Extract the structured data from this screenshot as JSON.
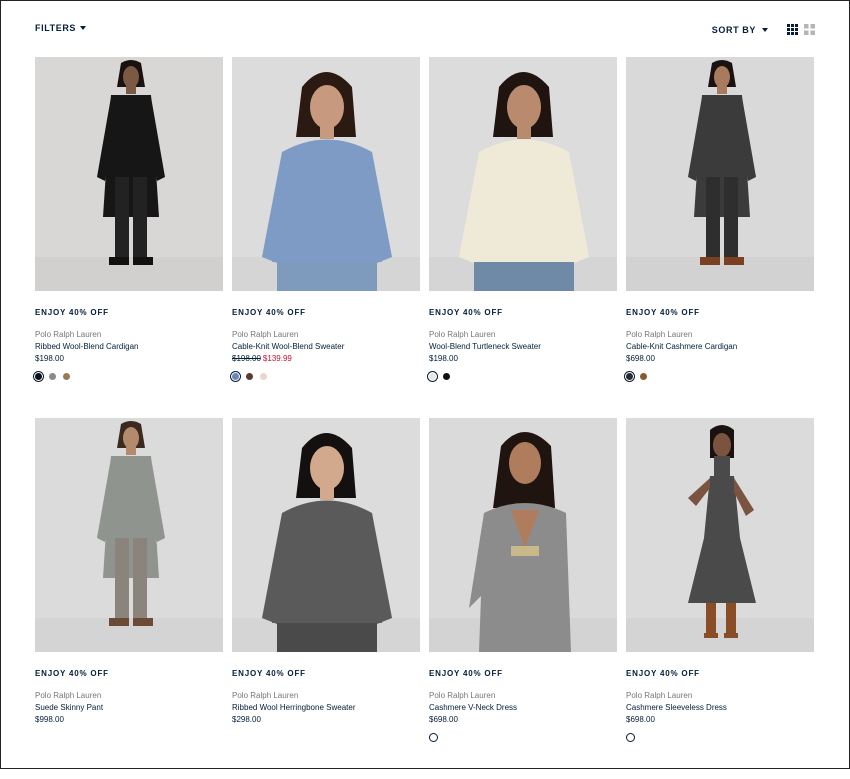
{
  "toolbar": {
    "filters_label": "FILTERS",
    "sort_label": "SORT BY"
  },
  "products": [
    {
      "promo": "ENJOY 40% OFF",
      "brand": "Polo Ralph Lauren",
      "name": "Ribbed Wool-Blend Cardigan",
      "price": "$198.00",
      "sale_price": "",
      "swatches": [
        "#111111",
        "#8a8a8a",
        "#9a7a52"
      ],
      "selected_swatch": 0,
      "look": {
        "bg": "#d8d7d5",
        "top": "#161616",
        "bottom": "#222222",
        "skin": "#7a5a44",
        "hair": "#1a1210",
        "shoes": "#111111",
        "style": "long-coat"
      }
    },
    {
      "promo": "ENJOY 40% OFF",
      "brand": "Polo Ralph Lauren",
      "name": "Cable-Knit Wool-Blend Sweater",
      "price": "$198.00",
      "sale_price": "$139.99",
      "swatches": [
        "#6f86b3",
        "#5a3a32",
        "#e9d6d0"
      ],
      "selected_swatch": 0,
      "look": {
        "bg": "#dcdcdc",
        "top": "#7e9bc6",
        "bottom": "#7e9bbd",
        "skin": "#c79a7f",
        "hair": "#2a1a12",
        "shoes": "#7e9bbd",
        "style": "crop"
      }
    },
    {
      "promo": "ENJOY 40% OFF",
      "brand": "Polo Ralph Lauren",
      "name": "Wool-Blend Turtleneck Sweater",
      "price": "$198.00",
      "sale_price": "",
      "swatches": [
        "#ece8dc",
        "#111111"
      ],
      "selected_swatch": 0,
      "look": {
        "bg": "#dcdcdc",
        "top": "#efead8",
        "bottom": "#6f8aa6",
        "skin": "#b98a6e",
        "hair": "#1f1410",
        "shoes": "#6f8aa6",
        "style": "crop"
      }
    },
    {
      "promo": "ENJOY 40% OFF",
      "brand": "Polo Ralph Lauren",
      "name": "Cable-Knit Cashmere Cardigan",
      "price": "$698.00",
      "sale_price": "",
      "swatches": [
        "#2b2b2b",
        "#8a5a2e"
      ],
      "selected_swatch": 0,
      "look": {
        "bg": "#d9d9d9",
        "top": "#3b3b3b",
        "bottom": "#2e2e2e",
        "skin": "#a87b5e",
        "hair": "#1a1210",
        "shoes": "#7b3f22",
        "style": "long-coat"
      }
    },
    {
      "promo": "ENJOY 40% OFF",
      "brand": "Polo Ralph Lauren",
      "name": "Suede Skinny Pant",
      "price": "$998.00",
      "sale_price": "",
      "swatches": [],
      "selected_swatch": -1,
      "look": {
        "bg": "#dbdbdb",
        "top": "#8f948e",
        "bottom": "#8a847c",
        "skin": "#b48a6c",
        "hair": "#3a2a20",
        "shoes": "#6b4a36",
        "style": "long-coat"
      }
    },
    {
      "promo": "ENJOY 40% OFF",
      "brand": "Polo Ralph Lauren",
      "name": "Ribbed Wool Herringbone Sweater",
      "price": "$298.00",
      "sale_price": "",
      "swatches": [],
      "selected_swatch": -1,
      "look": {
        "bg": "#dcdcdc",
        "top": "#5a5a5a",
        "bottom": "#4a4a4a",
        "skin": "#d2a98c",
        "hair": "#151010",
        "shoes": "#4a4a4a",
        "style": "crop"
      }
    },
    {
      "promo": "ENJOY 40% OFF",
      "brand": "Polo Ralph Lauren",
      "name": "Cashmere V-Neck Dress",
      "price": "$698.00",
      "sale_price": "",
      "swatches": [
        "empty"
      ],
      "selected_swatch": -1,
      "look": {
        "bg": "#dadada",
        "top": "#8c8c8c",
        "bottom": "#8c8c8c",
        "skin": "#b07c5e",
        "hair": "#1f1410",
        "shoes": "#8c8c8c",
        "style": "dress-crop"
      }
    },
    {
      "promo": "ENJOY 40% OFF",
      "brand": "Polo Ralph Lauren",
      "name": "Cashmere Sleeveless Dress",
      "price": "$698.00",
      "sale_price": "",
      "swatches": [
        "empty"
      ],
      "selected_swatch": -1,
      "look": {
        "bg": "#dbdbdb",
        "top": "#4a4a4a",
        "bottom": "#4a4a4a",
        "skin": "#7a5440",
        "hair": "#1a1210",
        "shoes": "#8a4e26",
        "style": "dress-full"
      }
    }
  ]
}
